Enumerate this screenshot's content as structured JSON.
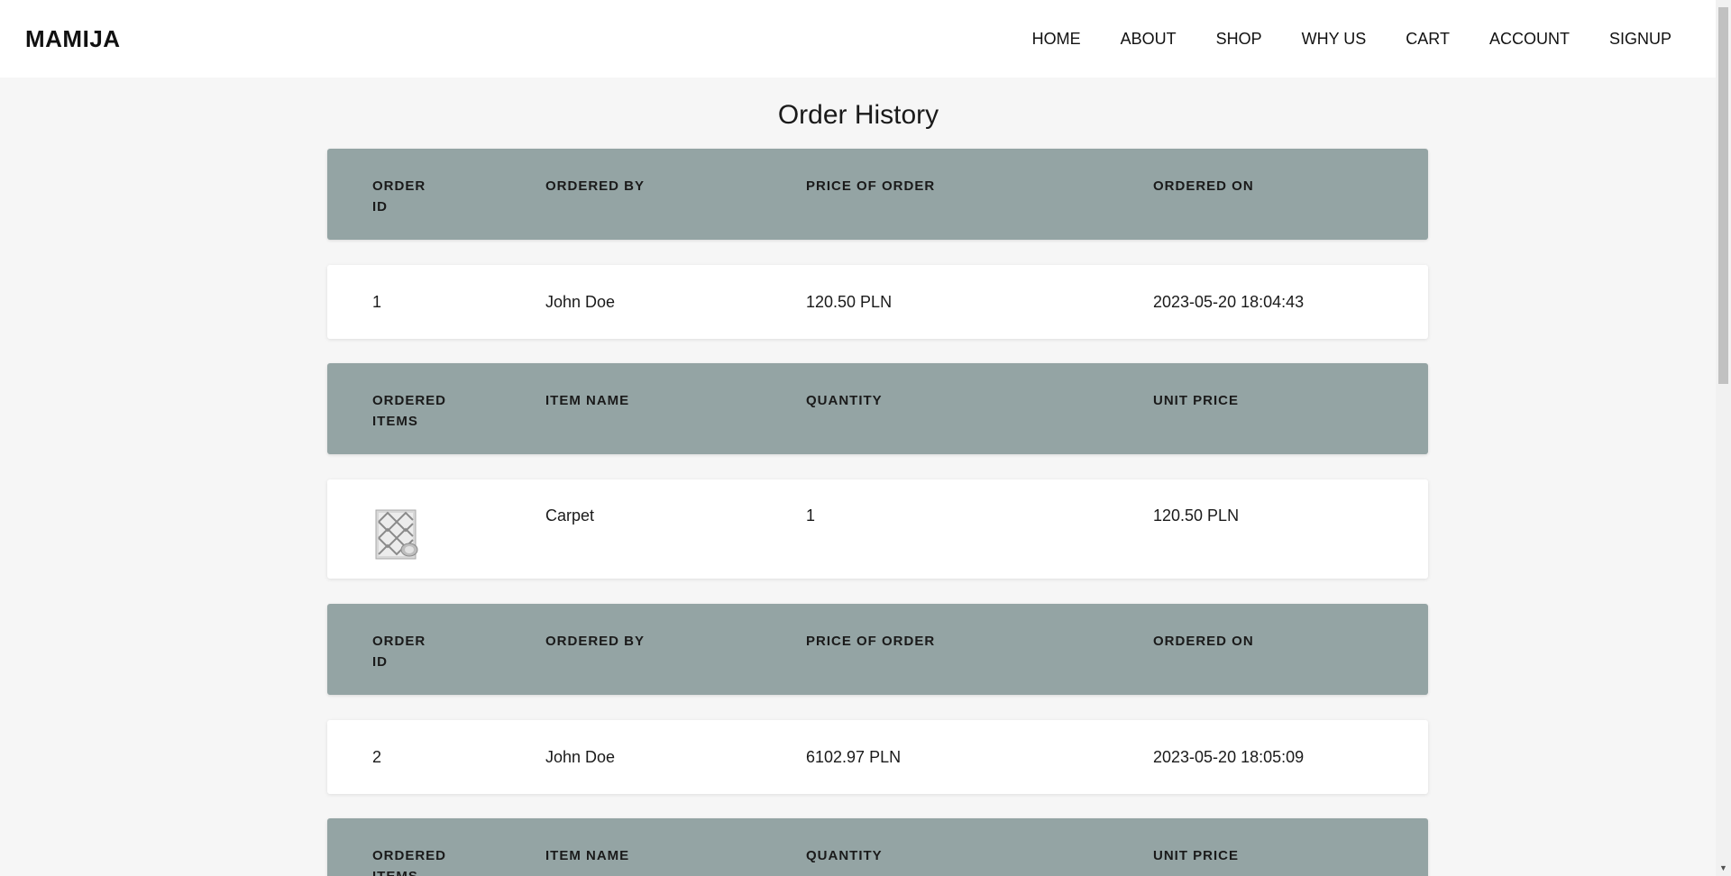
{
  "brand": "MAMIJA",
  "nav": [
    "HOME",
    "ABOUT",
    "SHOP",
    "WHY US",
    "CART",
    "ACCOUNT",
    "SIGNUP"
  ],
  "page_title": "Order History",
  "order_headers": [
    "ORDER ID",
    "ORDERED BY",
    "PRICE OF ORDER",
    "ORDERED ON"
  ],
  "item_headers": [
    "ORDERED ITEMS",
    "ITEM NAME",
    "QUANTITY",
    "UNIT PRICE"
  ],
  "orders": [
    {
      "id": "1",
      "by": "John Doe",
      "price": "120.50 PLN",
      "on": "2023-05-20 18:04:43",
      "items": [
        {
          "icon": "carpet-thumbnail-icon",
          "name": "Carpet",
          "qty": "1",
          "unit_price": "120.50 PLN"
        }
      ]
    },
    {
      "id": "2",
      "by": "John Doe",
      "price": "6102.97 PLN",
      "on": "2023-05-20 18:05:09",
      "items": []
    }
  ],
  "colors": {
    "header_bg": "#94a4a4",
    "page_bg": "#f6f6f6",
    "row_bg": "#ffffff"
  }
}
